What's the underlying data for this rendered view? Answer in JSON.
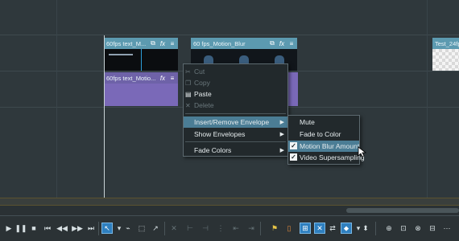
{
  "clips": {
    "top_left_title": "60fps text_M...",
    "top_mid_title": "60 fps_Motion_Blur",
    "top_right_title": "Test_24fp",
    "purple_title": "60fps text_Motio..."
  },
  "context_menu": {
    "items": [
      {
        "label": "Cut",
        "enabled": false,
        "icon": "scissors-icon"
      },
      {
        "label": "Copy",
        "enabled": false,
        "icon": "copy-icon"
      },
      {
        "label": "Paste",
        "enabled": true,
        "icon": "paste-icon"
      },
      {
        "label": "Delete",
        "enabled": false,
        "icon": "delete-icon"
      }
    ],
    "submenus": [
      {
        "label": "Insert/Remove Envelope",
        "highlighted": true
      },
      {
        "label": "Show Envelopes",
        "highlighted": false
      },
      {
        "label": "Fade Colors",
        "highlighted": false
      }
    ]
  },
  "envelope_submenu": {
    "items": [
      {
        "label": "Mute",
        "checked": false
      },
      {
        "label": "Fade to Color",
        "checked": false
      },
      {
        "label": "Motion Blur Amount",
        "checked": true,
        "highlighted": true
      },
      {
        "label": "Video Supersampling",
        "checked": true
      }
    ]
  },
  "colors": {
    "accent": "#2e7fbf",
    "clip_blue": "#5c9ab0",
    "clip_purple": "#6e62a8",
    "menu_highlight": "#4b7d95"
  }
}
